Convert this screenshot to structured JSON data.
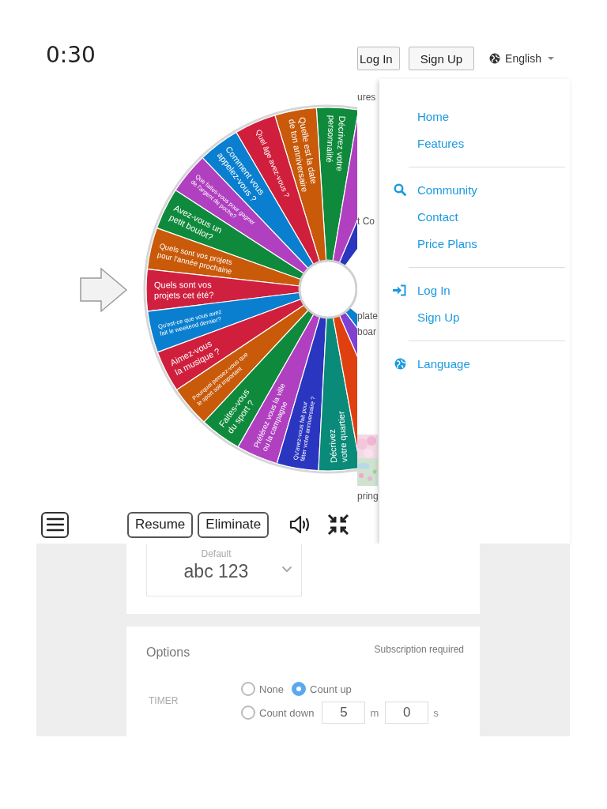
{
  "timer": "0:30",
  "wheel": {
    "segments": [
      {
        "lines": [
          "Décrivez votre",
          "personnalité"
        ],
        "color": "#0f8a3c"
      },
      {
        "lines": [
          "Quelle est la date",
          "de ton anniversaire"
        ],
        "color": "#c85a0a"
      },
      {
        "lines": [
          "Quel âge avez-vous ?"
        ],
        "color": "#d01f3c"
      },
      {
        "lines": [
          "Comment vous",
          "appelez-vous ?"
        ],
        "color": "#0a7fd0"
      },
      {
        "lines": [
          "Que faites-vous pour gagner",
          "de l'argent de poche?"
        ],
        "color": "#b040c0"
      },
      {
        "lines": [
          "Avez-vous un",
          "petit boulot?"
        ],
        "color": "#0f8a3c"
      },
      {
        "lines": [
          "Quels sont vos projets",
          "pour l'année prochaine"
        ],
        "color": "#c85a0a"
      },
      {
        "lines": [
          "Quels sont vos",
          "projets cet été?"
        ],
        "color": "#d02040"
      },
      {
        "lines": [
          "Qu'est-ce que vous avez",
          "fait le weekend dernier?"
        ],
        "color": "#0a7fd0"
      },
      {
        "lines": [
          "Aimez-vous",
          "la musique ?"
        ],
        "color": "#d01f3c"
      },
      {
        "lines": [
          "Pourquoi pensez-vous que",
          "le sport soit important"
        ],
        "color": "#c85a0a"
      },
      {
        "lines": [
          "Faites-vous",
          "du sport ?"
        ],
        "color": "#0f8a3c"
      },
      {
        "lines": [
          "Préférez vous la ville",
          "ou la campagne"
        ],
        "color": "#b040c0"
      },
      {
        "lines": [
          "Qu'avez-vous fait pour",
          "fêter votre anniversaire ?"
        ],
        "color": "#2a35c0"
      },
      {
        "lines": [
          "Décrivez",
          "votre quartier"
        ],
        "color": "#0a8a78"
      },
      {
        "color": "#e04010"
      },
      {
        "color": "#8040d0"
      },
      {
        "color": "#0a7fd0"
      }
    ],
    "top_right_segments": [
      {
        "color": "#2a35c0"
      },
      {
        "color": "#b040c0"
      }
    ]
  },
  "toolbar": {
    "buttons": [
      "Resume",
      "Eliminate"
    ]
  },
  "header": {
    "buttons": [
      "Log In",
      "Sign Up"
    ],
    "language": "English"
  },
  "background_fragments": [
    {
      "kind": "text",
      "text": "ures"
    },
    {
      "kind": "text",
      "text": "t Co"
    },
    {
      "kind": "text",
      "text": "plate"
    },
    {
      "kind": "text",
      "text": "boar"
    },
    {
      "kind": "picture"
    },
    {
      "kind": "text",
      "text": "pring"
    }
  ],
  "menu": {
    "groups": [
      [
        {
          "label": "Home",
          "kind": "plain"
        },
        {
          "label": "Features",
          "kind": "plain"
        }
      ],
      [
        {
          "label": "Community",
          "kind": "search"
        },
        {
          "label": "Contact",
          "kind": "plain"
        },
        {
          "label": "Price Plans",
          "kind": "plain"
        }
      ],
      [
        {
          "label": "Log In",
          "kind": "login"
        },
        {
          "label": "Sign Up",
          "kind": "plain"
        }
      ],
      [
        {
          "label": "Language",
          "kind": "globe"
        }
      ]
    ]
  },
  "font_select": {
    "label": "Default",
    "value": "abc 123"
  },
  "options": {
    "title": "Options",
    "note": "Subscription required",
    "timer": {
      "label": "TIMER",
      "choices": [
        {
          "label": "None",
          "selected": false
        },
        {
          "label": "Count up",
          "selected": true
        },
        {
          "label": "Count down",
          "selected": false
        }
      ],
      "minutes": "5",
      "minutes_unit": "m",
      "seconds": "0",
      "seconds_unit": "s"
    }
  }
}
